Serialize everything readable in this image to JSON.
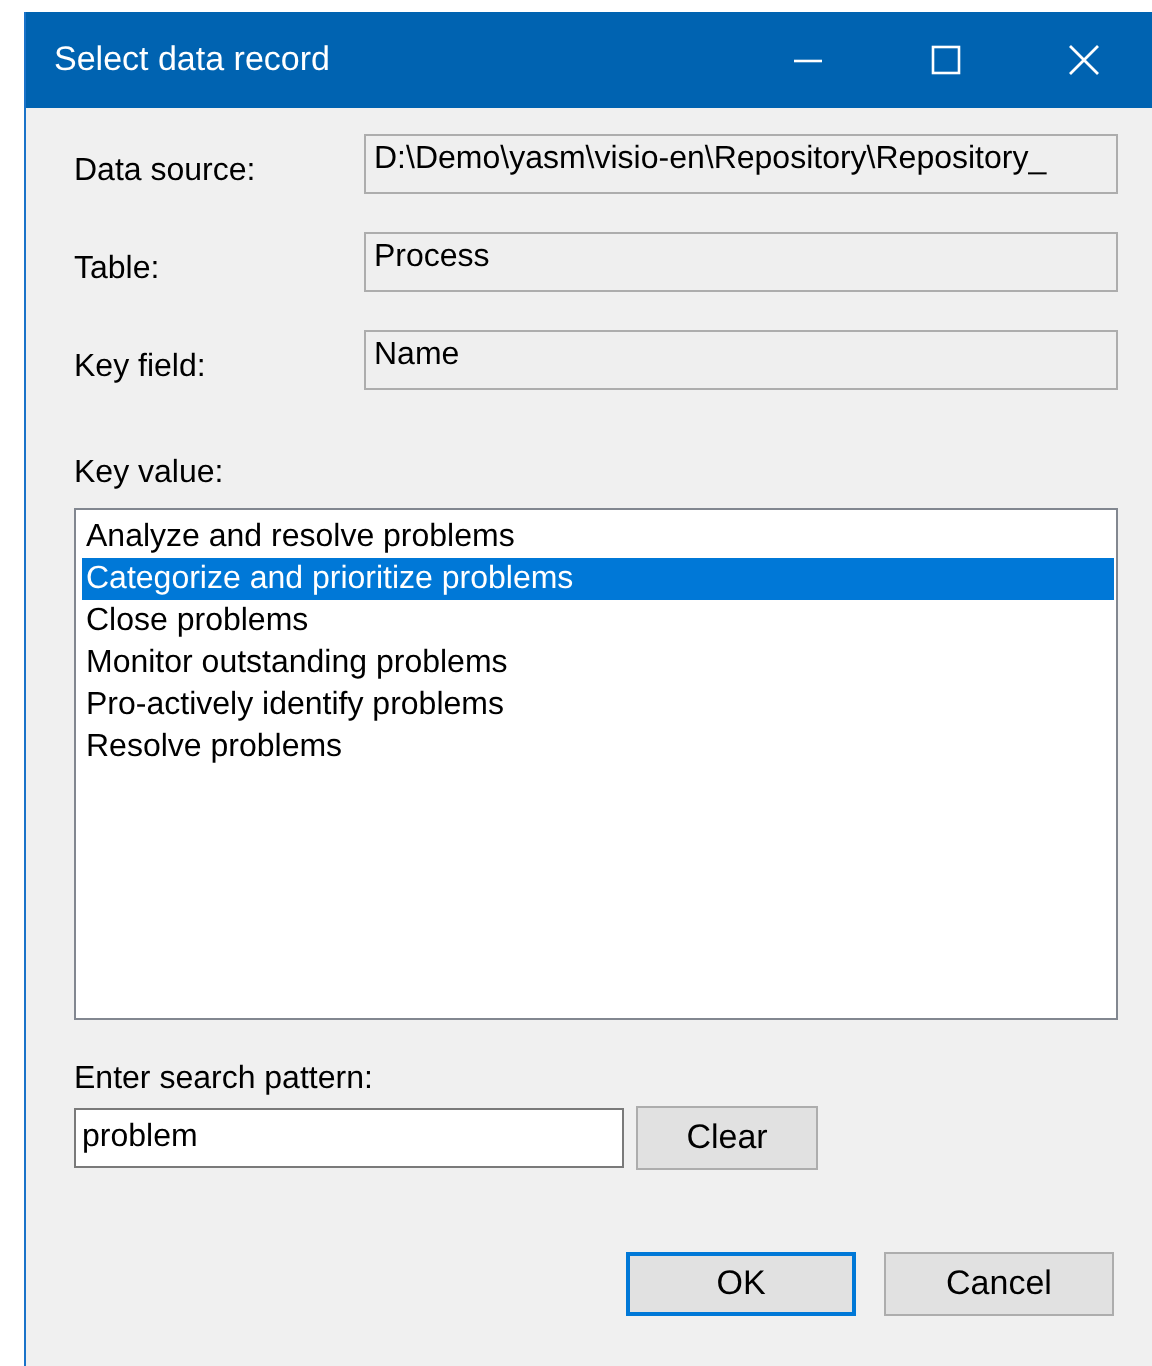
{
  "window": {
    "title": "Select data record"
  },
  "fields": [
    {
      "label": "Data source:",
      "value": "D:\\Demo\\yasm\\visio-en\\Repository\\Repository_"
    },
    {
      "label": "Table:",
      "value": "Process"
    },
    {
      "label": "Key field:",
      "value": "Name"
    }
  ],
  "key_value": {
    "label": "Key value:",
    "items": [
      {
        "text": "Analyze and resolve problems",
        "selected": false
      },
      {
        "text": "Categorize and prioritize problems",
        "selected": true
      },
      {
        "text": "Close problems",
        "selected": false
      },
      {
        "text": "Monitor outstanding problems",
        "selected": false
      },
      {
        "text": "Pro-actively identify problems",
        "selected": false
      },
      {
        "text": "Resolve problems",
        "selected": false
      }
    ]
  },
  "search": {
    "label": "Enter search pattern:",
    "value": "problem",
    "button": "Clear"
  },
  "buttons": [
    {
      "label": "OK",
      "default": true
    },
    {
      "label": "Cancel",
      "default": false
    }
  ]
}
